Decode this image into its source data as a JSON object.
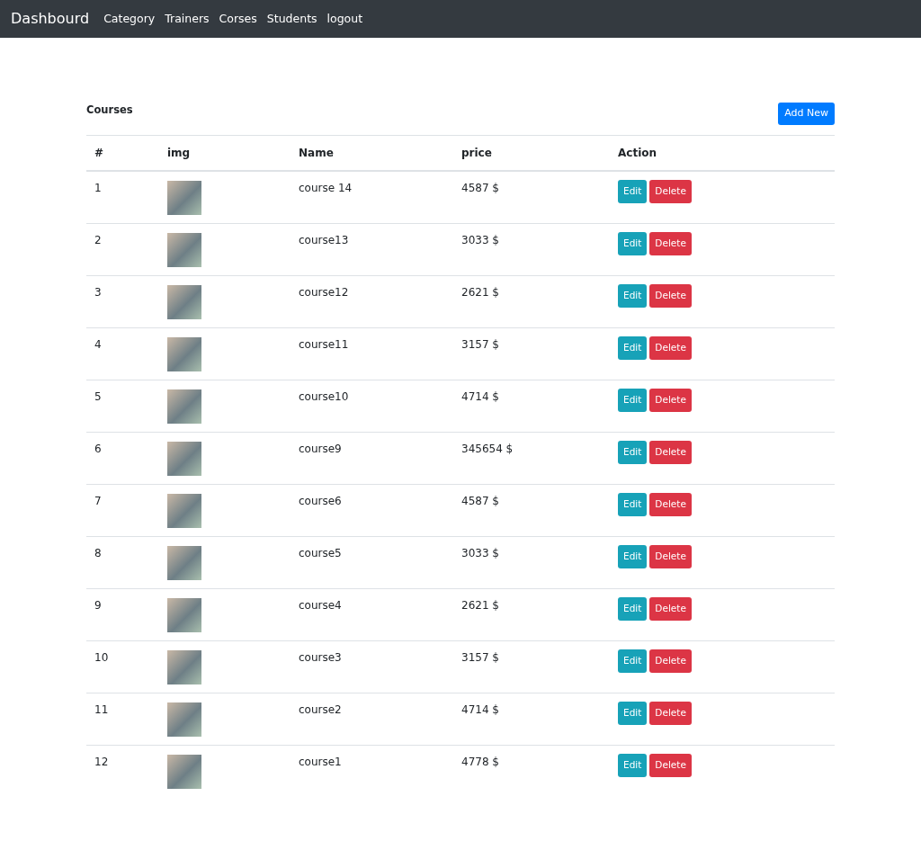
{
  "navbar": {
    "brand": "Dashbourd",
    "links": [
      "Category",
      "Trainers",
      "Corses",
      "Students",
      "logout"
    ]
  },
  "page": {
    "title": "Courses",
    "add_button": "Add New"
  },
  "table": {
    "columns": [
      "#",
      "img",
      "Name",
      "price",
      "Action"
    ],
    "rows": [
      {
        "index": "1",
        "name": "course 14",
        "price": "4587 $",
        "edit": "Edit",
        "delete": "Delete"
      },
      {
        "index": "2",
        "name": "course13",
        "price": "3033 $",
        "edit": "Edit",
        "delete": "Delete"
      },
      {
        "index": "3",
        "name": "course12",
        "price": "2621 $",
        "edit": "Edit",
        "delete": "Delete"
      },
      {
        "index": "4",
        "name": "course11",
        "price": "3157 $",
        "edit": "Edit",
        "delete": "Delete"
      },
      {
        "index": "5",
        "name": "course10",
        "price": "4714 $",
        "edit": "Edit",
        "delete": "Delete"
      },
      {
        "index": "6",
        "name": "course9",
        "price": "345654 $",
        "edit": "Edit",
        "delete": "Delete"
      },
      {
        "index": "7",
        "name": "course6",
        "price": "4587 $",
        "edit": "Edit",
        "delete": "Delete"
      },
      {
        "index": "8",
        "name": "course5",
        "price": "3033 $",
        "edit": "Edit",
        "delete": "Delete"
      },
      {
        "index": "9",
        "name": "course4",
        "price": "2621 $",
        "edit": "Edit",
        "delete": "Delete"
      },
      {
        "index": "10",
        "name": "course3",
        "price": "3157 $",
        "edit": "Edit",
        "delete": "Delete"
      },
      {
        "index": "11",
        "name": "course2",
        "price": "4714 $",
        "edit": "Edit",
        "delete": "Delete"
      },
      {
        "index": "12",
        "name": "course1",
        "price": "4778 $",
        "edit": "Edit",
        "delete": "Delete"
      }
    ]
  }
}
